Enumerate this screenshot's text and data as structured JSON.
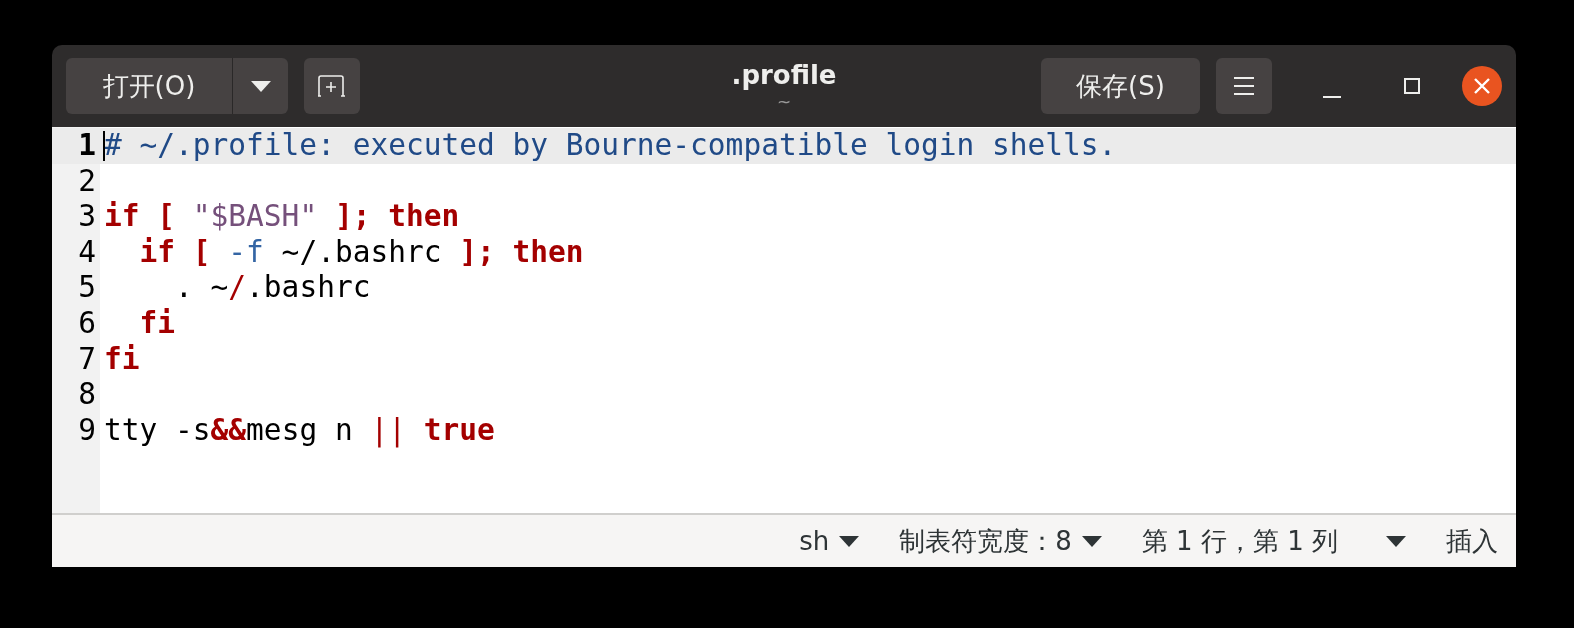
{
  "window": {
    "title": ".profile",
    "subtitle": "~"
  },
  "header": {
    "open_button": "打开(O)",
    "save_button": "保存(S)"
  },
  "editor": {
    "lines": [
      {
        "number": "1",
        "selected": true,
        "tokens": [
          {
            "kind": "comment",
            "text": "# ~/.profile: executed by Bourne-compatible login shells."
          }
        ]
      },
      {
        "number": "2",
        "selected": false
      },
      {
        "number": "3",
        "selected": false,
        "tokens": [
          {
            "kind": "keyword",
            "text": "if [ "
          },
          {
            "kind": "string",
            "text": "\"$BASH\" "
          },
          {
            "kind": "keyword",
            "text": "]; then"
          }
        ]
      },
      {
        "number": "4",
        "selected": false,
        "tokens": [
          {
            "kind": "keyword",
            "text": "  if [ "
          },
          {
            "kind": "option",
            "text": "-f"
          },
          {
            "kind": "plain",
            "text": " ~/.bashrc "
          },
          {
            "kind": "keyword",
            "text": "]; then"
          }
        ]
      },
      {
        "number": "5",
        "selected": false,
        "tokens": [
          {
            "kind": "plain",
            "text": "    . ~"
          },
          {
            "kind": "operator",
            "text": "/"
          },
          {
            "kind": "plain",
            "text": ".bashrc"
          }
        ]
      },
      {
        "number": "6",
        "selected": false,
        "tokens": [
          {
            "kind": "keyword",
            "text": "  fi"
          }
        ]
      },
      {
        "number": "7",
        "selected": false,
        "tokens": [
          {
            "kind": "keyword",
            "text": "fi"
          }
        ]
      },
      {
        "number": "8",
        "selected": false
      },
      {
        "number": "9",
        "selected": false,
        "tokens": [
          {
            "kind": "plain",
            "text": "tty -s"
          },
          {
            "kind": "keyword",
            "text": "&&"
          },
          {
            "kind": "plain",
            "text": "mesg n "
          },
          {
            "kind": "operator",
            "text": "||"
          },
          {
            "kind": "keyword",
            "text": " true"
          }
        ]
      }
    ]
  },
  "status_bar": [
    {
      "label": "sh",
      "dropdown": true
    },
    {
      "label": "制表符宽度：8",
      "dropdown": true
    },
    {
      "label": "第 1 行，第 1 列",
      "dropdown": true
    },
    {
      "label": "插入",
      "dropdown": false
    }
  ]
}
